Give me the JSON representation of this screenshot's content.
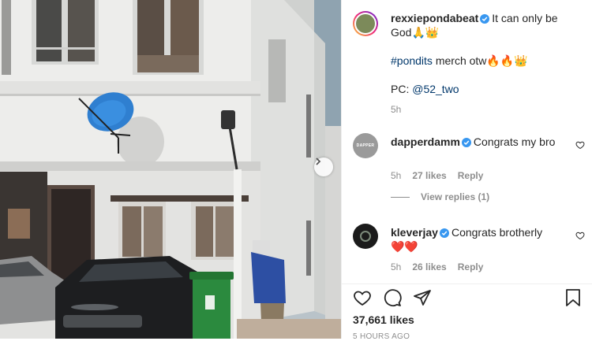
{
  "caption": {
    "username": "rexxiepondabeat",
    "line1": "It can only be God",
    "line1_emoji": "🙏👑",
    "hashtag": "#pondits",
    "line2_rest": " merch otw",
    "line2_emoji": "🔥🔥👑",
    "pc_label": "PC: ",
    "pc_mention": "@52_two",
    "time": "5h"
  },
  "comments": [
    {
      "username": "dapperdamm",
      "text": "Congrats my bro",
      "time": "5h",
      "likes": "27 likes",
      "reply": "Reply",
      "avatar_label": "DAPPER"
    },
    {
      "username": "kleverjay",
      "text": "Congrats brotherly",
      "text_emoji": "❤️❤️",
      "time": "5h",
      "likes": "26 likes",
      "reply": "Reply"
    }
  ],
  "view_replies": "View replies (1)",
  "likes_count": "37,661 likes",
  "posted_ago": "5 HOURS AGO",
  "icons": {
    "like": "heart-icon",
    "comment": "comment-icon",
    "share": "paper-plane-icon",
    "save": "bookmark-icon",
    "verified": "verified-badge-icon",
    "carousel_next": "chevron-right-icon"
  },
  "colors": {
    "verified": "#3897f0",
    "link": "#00376b",
    "muted": "#8e8e8e",
    "text": "#262626"
  }
}
